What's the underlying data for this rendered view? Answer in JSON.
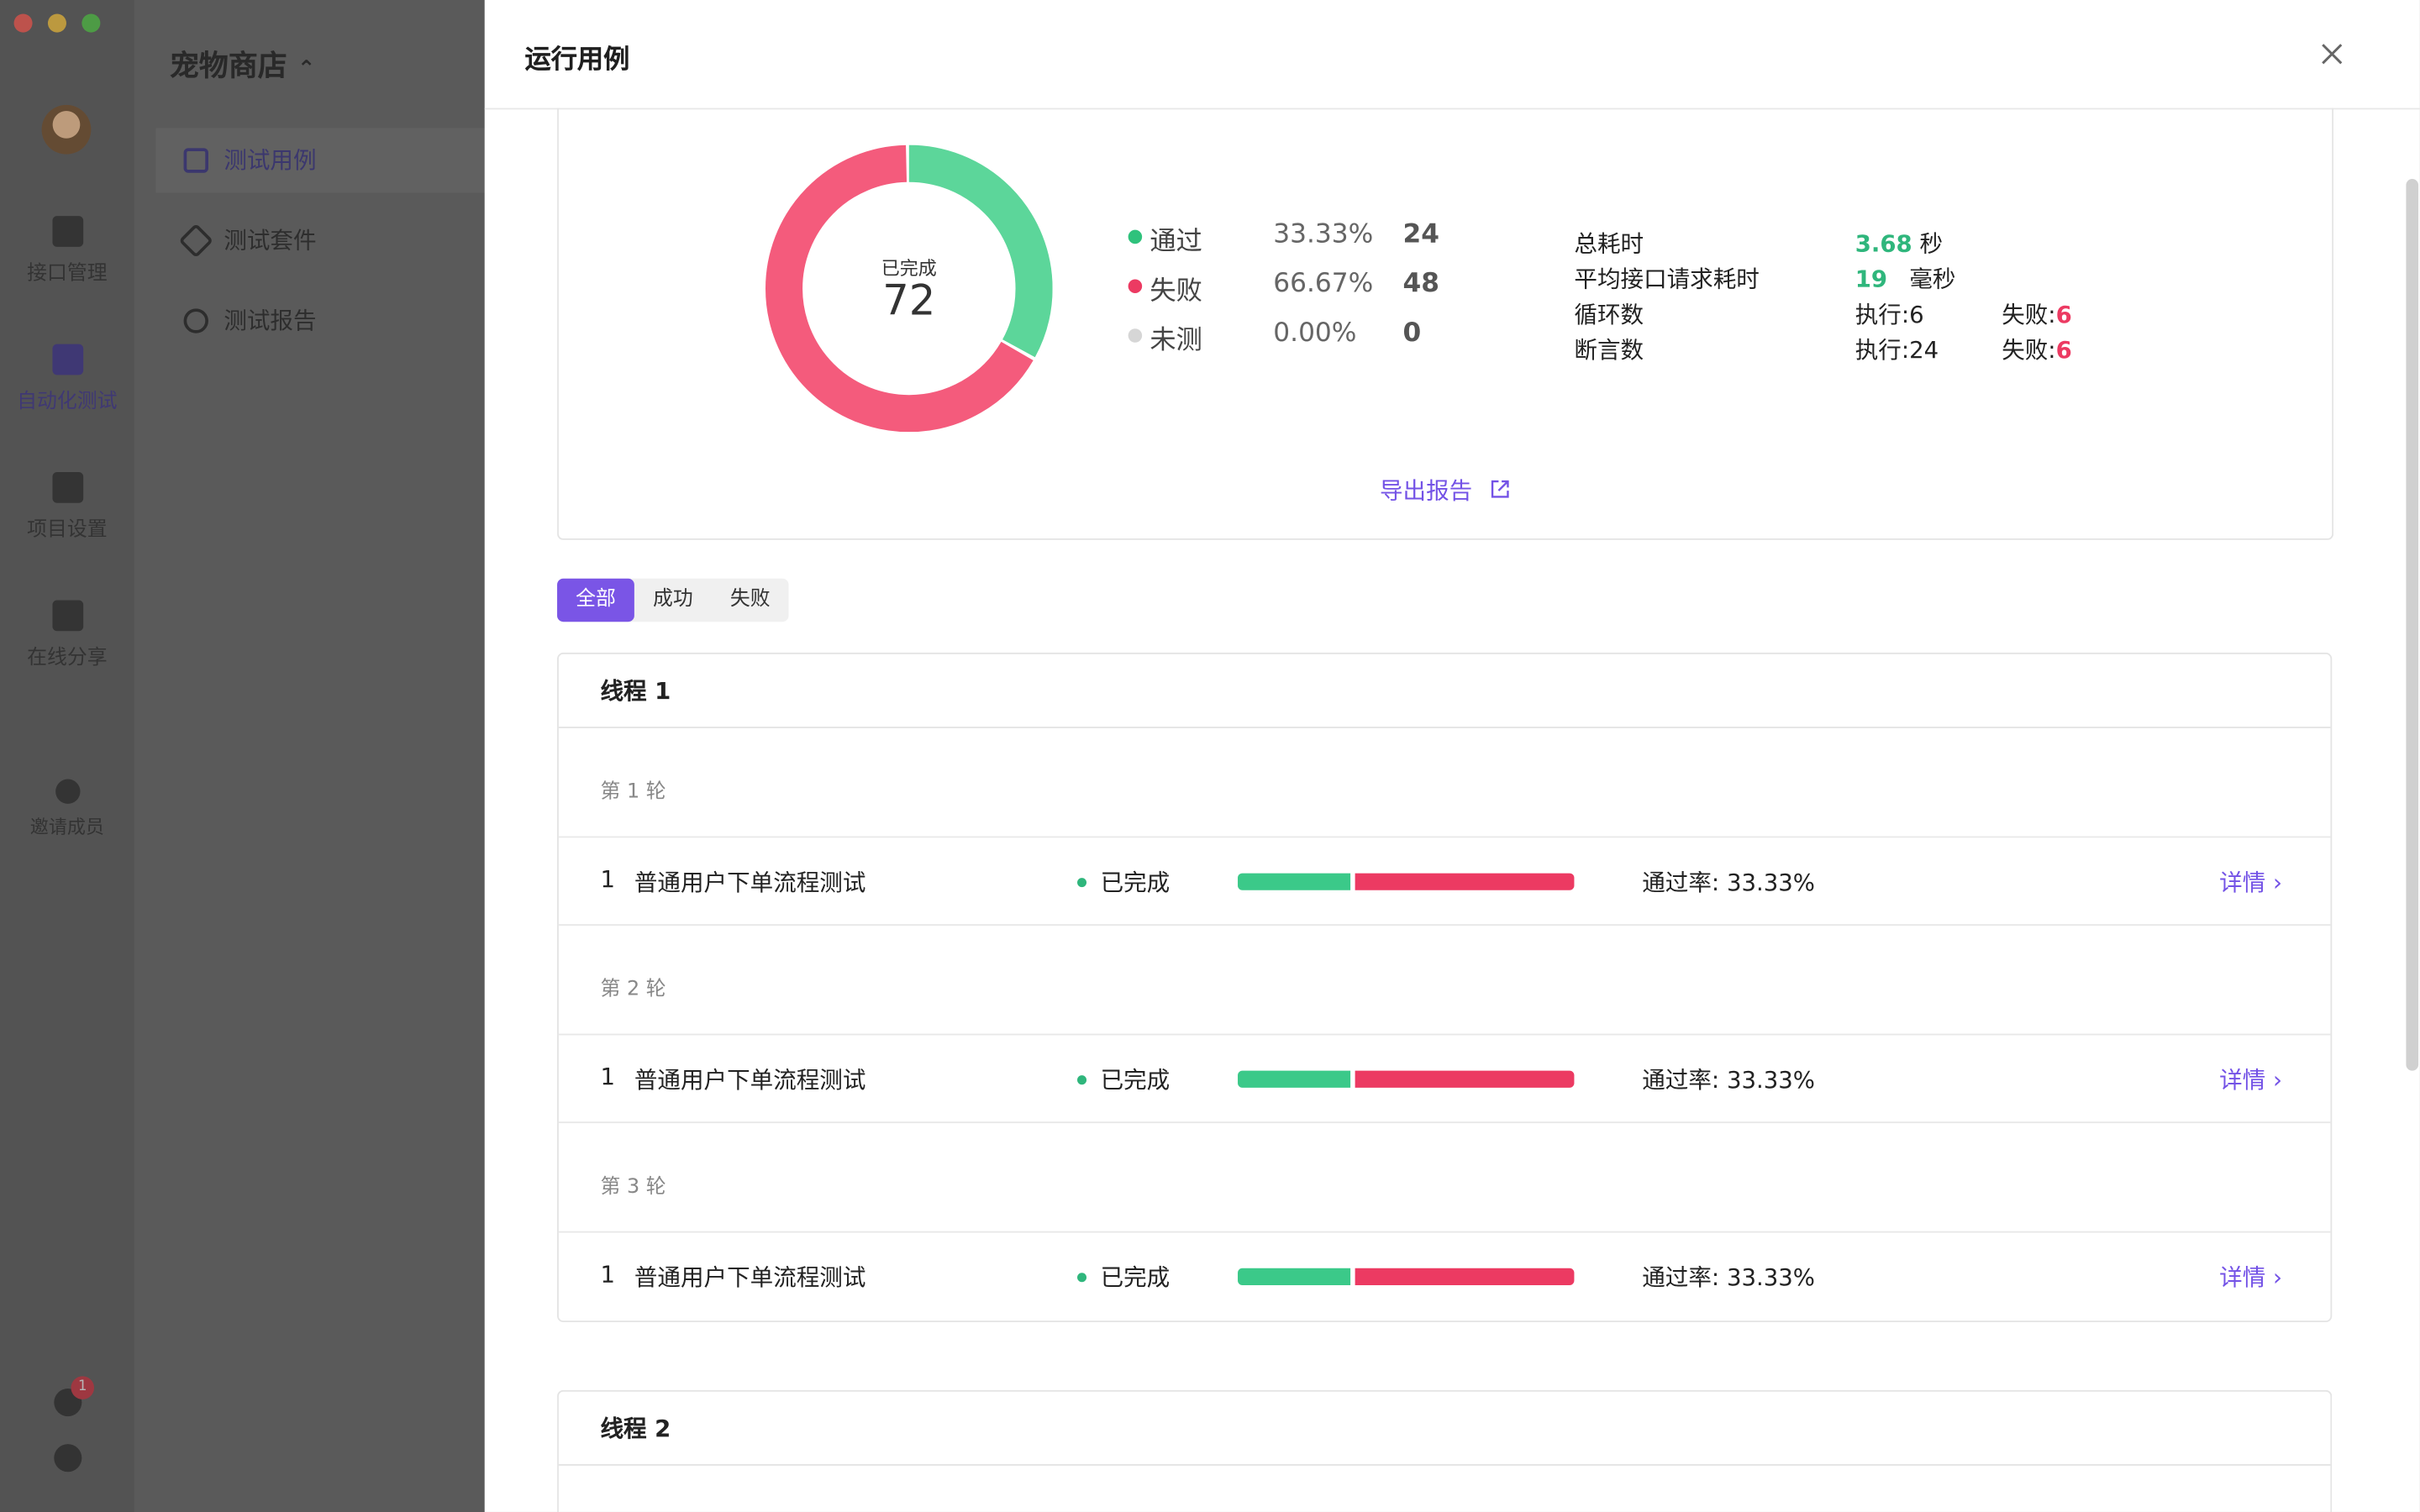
{
  "app": {
    "project_name": "宠物商店",
    "rail": [
      {
        "label": "接口管理",
        "icon": "api-icon"
      },
      {
        "label": "自动化测试",
        "icon": "automation-icon"
      },
      {
        "label": "项目设置",
        "icon": "settings-icon"
      },
      {
        "label": "在线分享",
        "icon": "share-icon"
      },
      {
        "label": "邀请成员",
        "icon": "invite-icon"
      }
    ],
    "notification_count": "1",
    "sidebar": [
      {
        "label": "测试用例",
        "icon": "test-case-icon"
      },
      {
        "label": "测试套件",
        "icon": "test-suite-icon"
      },
      {
        "label": "测试报告",
        "icon": "test-report-icon"
      }
    ]
  },
  "drawer": {
    "title": "运行用例",
    "summary": {
      "completed_label": "已完成",
      "total": "72",
      "legend": [
        {
          "name": "通过",
          "percent": "33.33%",
          "count": "24",
          "color": "#5cd69a"
        },
        {
          "name": "失败",
          "percent": "66.67%",
          "count": "48",
          "color": "#f45b7c"
        },
        {
          "name": "未测",
          "percent": "0.00%",
          "count": "0",
          "color": "#d6d6d6"
        }
      ],
      "stats": {
        "total_time_label": "总耗时",
        "total_time_value": "3.68",
        "total_time_unit": "秒",
        "avg_time_label": "平均接口请求耗时",
        "avg_time_value": "19",
        "avg_time_unit": "毫秒",
        "loops_label": "循环数",
        "loops_exec": "执行:6",
        "loops_fail_label": "失败:",
        "loops_fail_value": "6",
        "assert_label": "断言数",
        "assert_exec": "执行:24",
        "assert_fail_label": "失败:",
        "assert_fail_value": "6"
      },
      "export_label": "导出报告"
    },
    "filters": [
      "全部",
      "成功",
      "失败"
    ],
    "threads": [
      {
        "title": "线程 1",
        "rounds": [
          {
            "label": "第 1 轮",
            "case": {
              "no": "1",
              "name": "普通用户下单流程测试",
              "status": "已完成",
              "pass_ratio": 0.3333,
              "rate": "通过率: 33.33%",
              "detail": "详情 ›"
            }
          },
          {
            "label": "第 2 轮",
            "case": {
              "no": "1",
              "name": "普通用户下单流程测试",
              "status": "已完成",
              "pass_ratio": 0.3333,
              "rate": "通过率: 33.33%",
              "detail": "详情 ›"
            }
          },
          {
            "label": "第 3 轮",
            "case": {
              "no": "1",
              "name": "普通用户下单流程测试",
              "status": "已完成",
              "pass_ratio": 0.3333,
              "rate": "通过率: 33.33%",
              "detail": "详情 ›"
            }
          }
        ]
      },
      {
        "title": "线程 2"
      }
    ]
  }
}
